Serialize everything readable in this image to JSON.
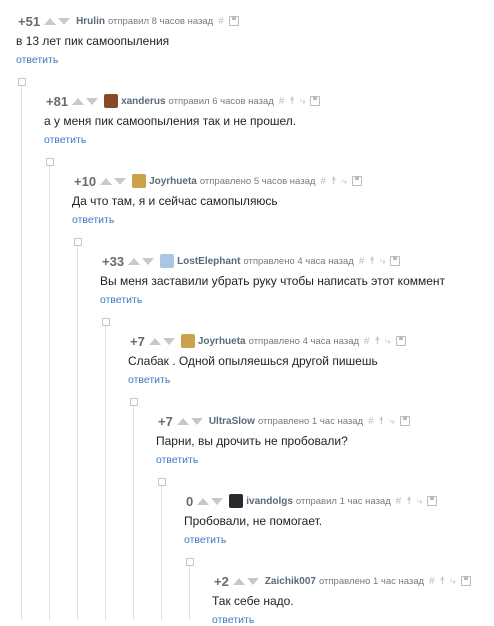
{
  "comments": [
    {
      "rating": "+51",
      "user": "Hrulin",
      "meta": "отправил 8 часов назад",
      "text": "в 13 лет  пик самоопыления",
      "reply": "ответить",
      "avatar": ""
    },
    {
      "rating": "+81",
      "user": "xanderus",
      "meta": "отправил 6 часов назад",
      "text": "а у меня пик самоопыления так и не прошел.",
      "reply": "ответить",
      "avatar": "#8a4a2a"
    },
    {
      "rating": "+10",
      "user": "Joyrhueta",
      "meta": "отправлено 5 часов назад",
      "text": "Да что там, я и сейчас самопыляюсь",
      "reply": "ответить",
      "avatar": "#c9a24a"
    },
    {
      "rating": "+33",
      "user": "LostElephant",
      "meta": "отправлено 4 часа назад",
      "text": "Вы меня заставили убрать руку чтобы написать этот коммент",
      "reply": "ответить",
      "avatar": "#a9c6e6"
    },
    {
      "rating": "+7",
      "user": "Joyrhueta",
      "meta": "отправлено 4 часа назад",
      "text": "Слабак . Одной опыляешься другой пишешь",
      "reply": "ответить",
      "avatar": "#c9a24a"
    },
    {
      "rating": "+7",
      "user": "UltraSlow",
      "meta": "отправлено 1 час назад",
      "text": "Парни, вы дрочить не пробовали?",
      "reply": "ответить",
      "avatar": ""
    },
    {
      "rating": "0",
      "user": "ivandolgs",
      "meta": "отправил 1 час назад",
      "text": "Пробовали, не помогает.",
      "reply": "ответить",
      "avatar": "#2a2a2a"
    },
    {
      "rating": "+2",
      "user": "Zaichik007",
      "meta": "отправлено 1 час назад",
      "text": "Так себе надо.",
      "reply": "ответить",
      "avatar": ""
    }
  ],
  "tools": {
    "hash": "#",
    "figure": "☨",
    "branch": "⤷"
  }
}
